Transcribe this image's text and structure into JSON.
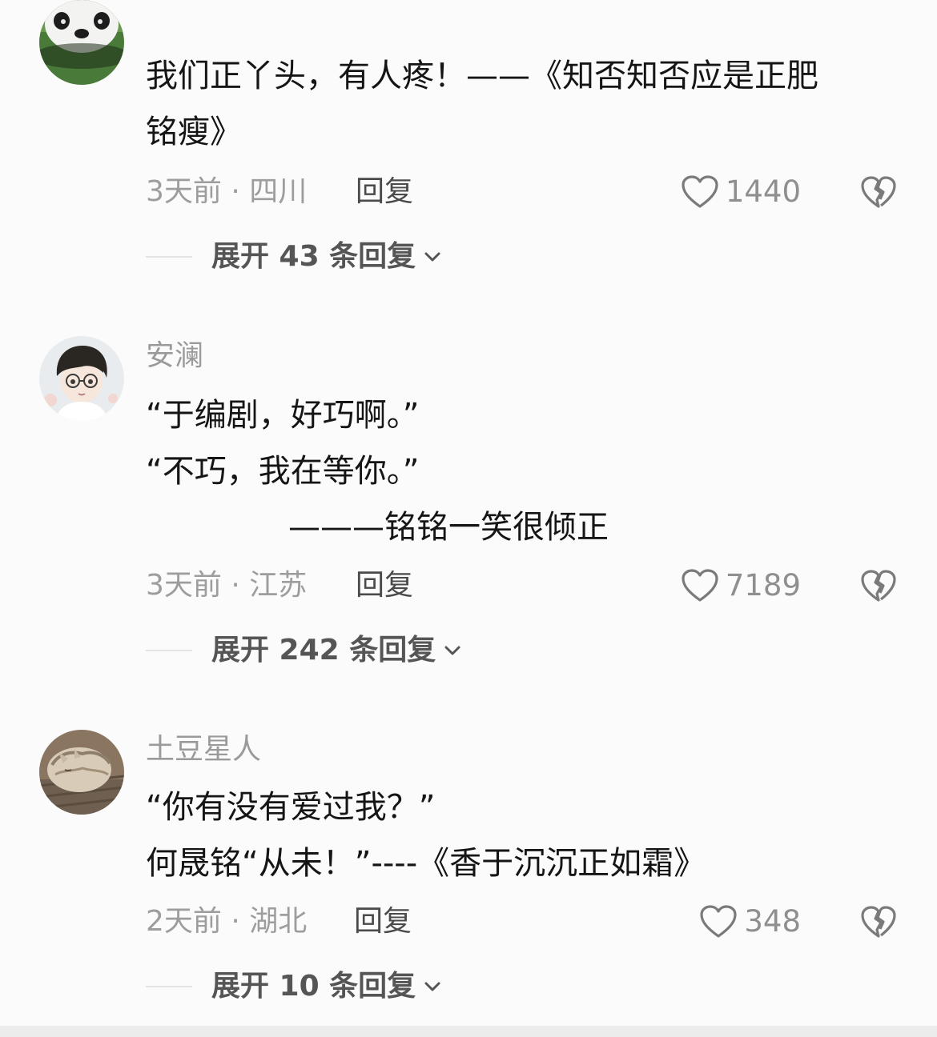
{
  "comments": [
    {
      "username": "",
      "content_lines": [
        "我们正丫头，有人疼！——《知否知否应是正肥",
        "铭瘦》"
      ],
      "time_location": "3天前 · 四川",
      "reply_label": "回复",
      "like_count": "1440",
      "expand_label": "展开 43 条回复"
    },
    {
      "username": "安澜",
      "content_lines": [
        "“于编剧，好巧啊。”",
        "“不巧，我在等你。”",
        "              ———铭铭一笑很倾正"
      ],
      "time_location": "3天前 · 江苏",
      "reply_label": "回复",
      "like_count": "7189",
      "expand_label": "展开 242 条回复"
    },
    {
      "username": "土豆星人",
      "content_lines": [
        "“你有没有爱过我？”",
        "何晟铭“从未！”----《香于沉沉正如霜》"
      ],
      "time_location": "2天前 · 湖北",
      "reply_label": "回复",
      "like_count": "348",
      "expand_label": "展开 10 条回复"
    }
  ],
  "icons": {
    "like": "heart-outline-icon",
    "dislike": "broken-heart-icon",
    "expand": "chevron-down-icon"
  },
  "colors": {
    "background": "#fbfbfb",
    "text_primary": "#151515",
    "text_secondary": "#9d9d9d",
    "icon": "#7a7a7a"
  }
}
